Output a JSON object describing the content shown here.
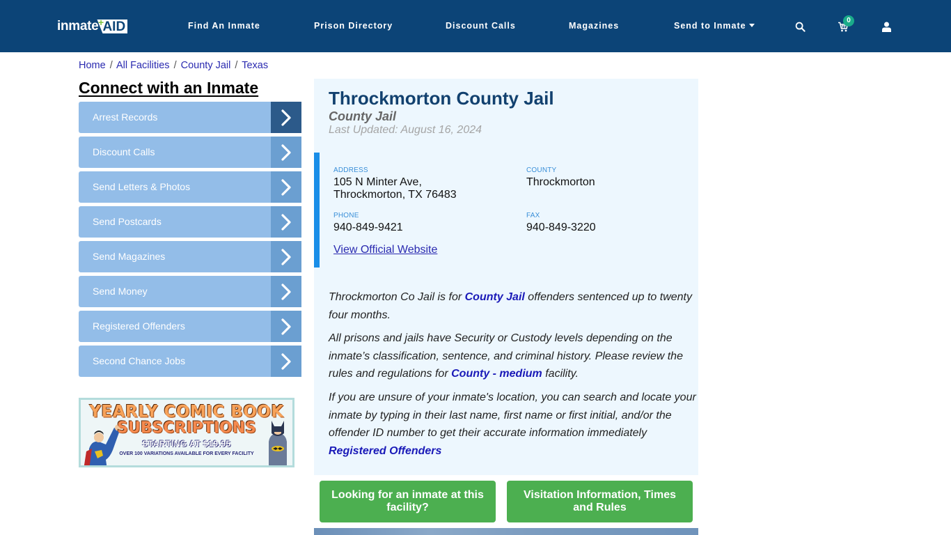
{
  "header": {
    "logo": {
      "part1": "inmate",
      "part2": "AID",
      "plus": "+"
    },
    "nav": [
      {
        "label": "Find An Inmate"
      },
      {
        "label": "Prison Directory"
      },
      {
        "label": "Discount Calls"
      },
      {
        "label": "Magazines"
      },
      {
        "label": "Send to Inmate"
      }
    ],
    "icons": [
      "search-icon",
      "cart-icon",
      "user-icon"
    ],
    "cart_count": "0"
  },
  "breadcrumb": {
    "items": [
      "Home",
      "All Facilities",
      "County Jail",
      "Texas"
    ],
    "separator": "/"
  },
  "sidebar": {
    "title": "Connect with an Inmate",
    "items": [
      {
        "label": "Arrest Records"
      },
      {
        "label": "Discount Calls"
      },
      {
        "label": "Send Letters & Photos"
      },
      {
        "label": "Send Postcards"
      },
      {
        "label": "Send Magazines"
      },
      {
        "label": "Send Money"
      },
      {
        "label": "Registered Offenders"
      },
      {
        "label": "Second Chance Jobs"
      }
    ],
    "ad": {
      "line1": "YEARLY COMIC BOOK",
      "line2": "SUBSCRIPTIONS",
      "line3": "STARTING AT $19.95",
      "line4": "OVER 100 VARIATIONS AVAILABLE FOR EVERY FACILITY"
    }
  },
  "facility": {
    "name": "Throckmorton County Jail",
    "type": "County Jail",
    "last_updated": "Last Updated: August 16, 2024",
    "address_label": "ADDRESS",
    "address_line1": "105 N Minter Ave,",
    "address_line2": "Throckmorton, TX 76483",
    "county_label": "COUNTY",
    "county": "Throckmorton",
    "phone_label": "PHONE",
    "phone": "940-849-9421",
    "fax_label": "FAX",
    "fax": "940-849-3220",
    "website_link": "View Official Website"
  },
  "description": {
    "p1_a": "Throckmorton Co Jail is for ",
    "p1_link": "County Jail",
    "p1_b": " offenders sentenced up to twenty four months.",
    "p2_a": "All prisons and jails have Security or Custody levels depending on the inmate’s classification, sentence, and criminal history. Please review the rules and regulations for ",
    "p2_link": "County - medium",
    "p2_b": " facility.",
    "p3": "If you are unsure of your inmate's location, you can search and locate your inmate by typing in their last name, first name or first initial, and/or the offender ID number to get their accurate information immediately",
    "p3_link": "Registered Offenders"
  },
  "actions": {
    "find_inmate": "Looking for an inmate at this facility?",
    "visitation": "Visitation Information, Times and Rules"
  },
  "colors": {
    "navbar": "#0c4477",
    "sidebar_item": "#93bde8",
    "sidebar_arrow": "#6b9fd1",
    "sidebar_arrow_active": "#2c5a8a",
    "panel_bg": "#edf7fe",
    "accent_bar": "#1a8ee8",
    "green_button": "#4caf50",
    "cart_badge": "#1aab8a"
  }
}
